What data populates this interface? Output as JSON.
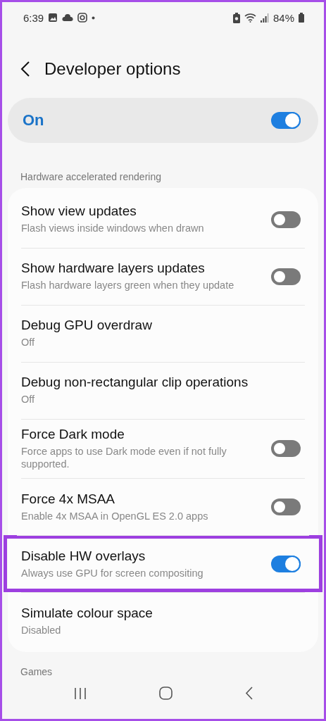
{
  "status_bar": {
    "time": "6:39",
    "battery": "84%"
  },
  "header": {
    "title": "Developer options"
  },
  "master": {
    "label": "On",
    "on": true
  },
  "section": "Hardware accelerated rendering",
  "items": [
    {
      "kind": "switch",
      "title": "Show view updates",
      "subtitle": "Flash views inside windows when drawn",
      "on": false,
      "highlighted": false
    },
    {
      "kind": "switch",
      "title": "Show hardware layers updates",
      "subtitle": "Flash hardware layers green when they update",
      "on": false,
      "highlighted": false
    },
    {
      "kind": "value",
      "title": "Debug GPU overdraw",
      "subtitle": "Off",
      "highlighted": false
    },
    {
      "kind": "value",
      "title": "Debug non-rectangular clip operations",
      "subtitle": "Off",
      "highlighted": false
    },
    {
      "kind": "switch",
      "title": "Force Dark mode",
      "subtitle": "Force apps to use Dark mode even if not fully supported.",
      "on": false,
      "highlighted": false
    },
    {
      "kind": "switch",
      "title": "Force 4x MSAA",
      "subtitle": "Enable 4x MSAA in OpenGL ES 2.0 apps",
      "on": false,
      "highlighted": false
    },
    {
      "kind": "switch",
      "title": "Disable HW overlays",
      "subtitle": "Always use GPU for screen compositing",
      "on": true,
      "highlighted": true
    },
    {
      "kind": "value",
      "title": "Simulate colour space",
      "subtitle": "Disabled",
      "highlighted": false
    }
  ],
  "next_section": "Games"
}
